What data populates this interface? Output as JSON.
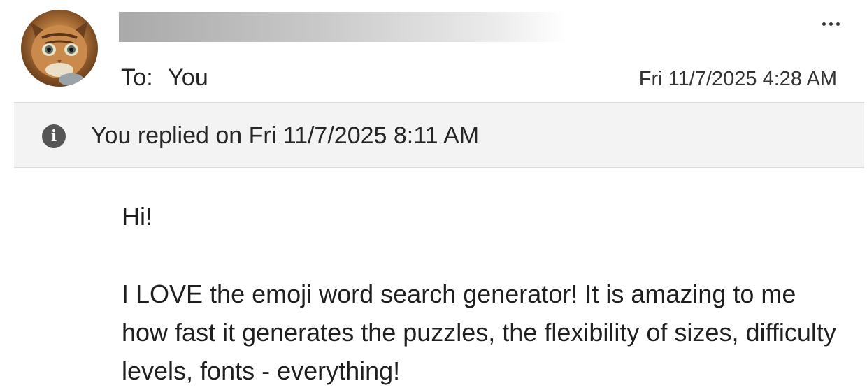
{
  "email": {
    "to_label": "To:",
    "to_value": "You",
    "date": "Fri 11/7/2025 4:28 AM",
    "more_icon": "more-dots-icon",
    "avatar_icon": "kitten-avatar"
  },
  "info": {
    "icon": "info-icon",
    "icon_glyph": "i",
    "text": "You replied on Fri 11/7/2025 8:11 AM"
  },
  "body": {
    "greeting": "Hi!",
    "paragraph": "I LOVE the emoji word search generator! It is amazing to me how fast it generates the puzzles, the flexibility of sizes, difficulty levels, fonts - everything!"
  }
}
